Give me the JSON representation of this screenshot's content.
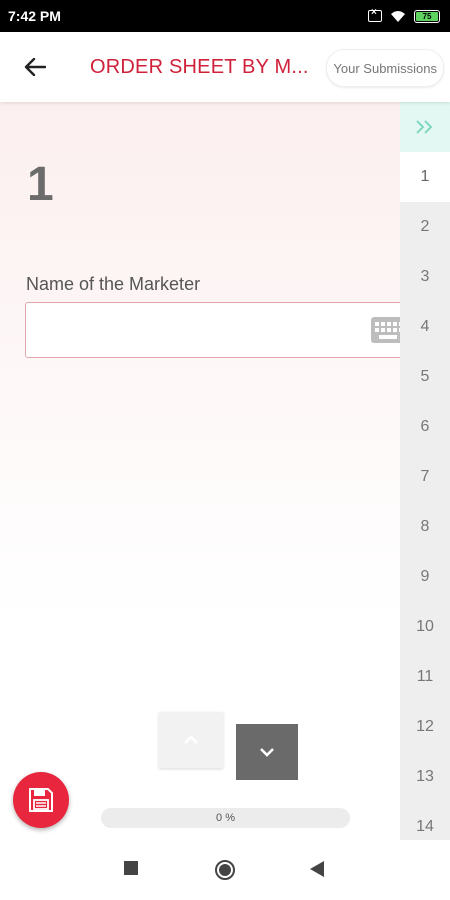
{
  "status_bar": {
    "time": "7:42 PM",
    "battery": "75"
  },
  "header": {
    "title": "ORDER SHEET BY M...",
    "submissions_label": "Your Submissions"
  },
  "question": {
    "number": "1",
    "label": "Name of the Marketer",
    "value": ""
  },
  "progress": {
    "text": "0 %",
    "value": 0
  },
  "side_nav": {
    "items": [
      "1",
      "2",
      "3",
      "4",
      "5",
      "6",
      "7",
      "8",
      "9",
      "10",
      "11",
      "12",
      "13",
      "14"
    ],
    "active_index": 0
  },
  "colors": {
    "accent": "#d0213a",
    "fab": "#e8273e",
    "expand_arrow": "#7fd7c0"
  },
  "icons": {
    "back": "arrow-left-icon",
    "keyboard": "keyboard-icon",
    "up": "chevron-up-icon",
    "down": "chevron-down-icon",
    "save": "floppy-disk-icon",
    "expand": "double-chevron-right-icon",
    "nav_square": "stop-square-icon",
    "nav_home": "home-circle-icon",
    "nav_back": "back-triangle-icon"
  }
}
